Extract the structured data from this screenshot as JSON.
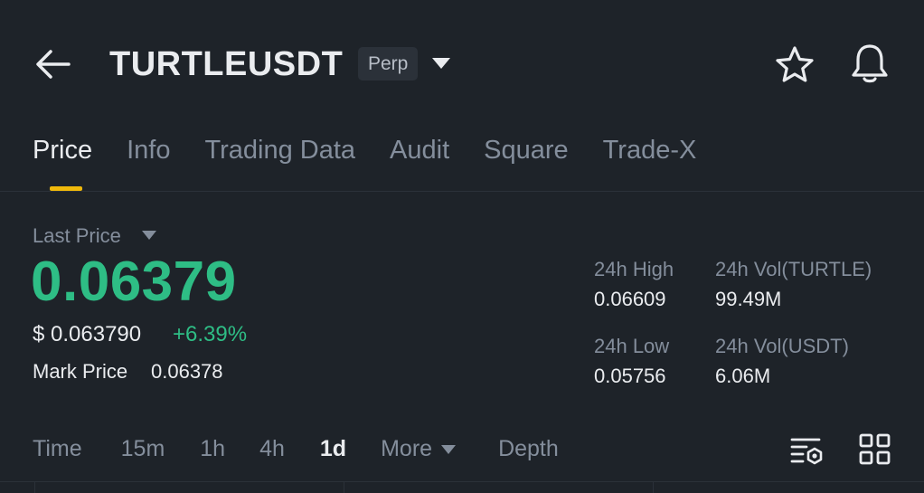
{
  "header": {
    "symbol": "TURTLEUSDT",
    "contract_type": "Perp",
    "icons": [
      "back-arrow-icon",
      "chevron-down-icon",
      "star-icon",
      "bell-icon"
    ]
  },
  "tabs": [
    {
      "label": "Price",
      "active": true
    },
    {
      "label": "Info",
      "active": false
    },
    {
      "label": "Trading Data",
      "active": false
    },
    {
      "label": "Audit",
      "active": false
    },
    {
      "label": "Square",
      "active": false
    },
    {
      "label": "Trade-X",
      "active": false
    }
  ],
  "price": {
    "last_price_label": "Last Price",
    "last_price": "0.06379",
    "usd_price": "$ 0.063790",
    "change_pct": "+6.39%",
    "mark_price_label": "Mark Price",
    "mark_price": "0.06378"
  },
  "stats": {
    "high_label": "24h High",
    "high_value": "0.06609",
    "low_label": "24h Low",
    "low_value": "0.05756",
    "vol_base_label": "24h Vol(TURTLE)",
    "vol_base_value": "99.49M",
    "vol_quote_label": "24h Vol(USDT)",
    "vol_quote_value": "6.06M"
  },
  "timeframes": {
    "time": "Time",
    "m15": "15m",
    "h1": "1h",
    "h4": "4h",
    "d1": "1d",
    "more": "More",
    "depth": "Depth",
    "selected": "1d"
  },
  "colors": {
    "background": "#1e2329",
    "up_green": "#2ebd85",
    "accent_yellow": "#f0b90b",
    "muted_text": "#848e9c"
  }
}
